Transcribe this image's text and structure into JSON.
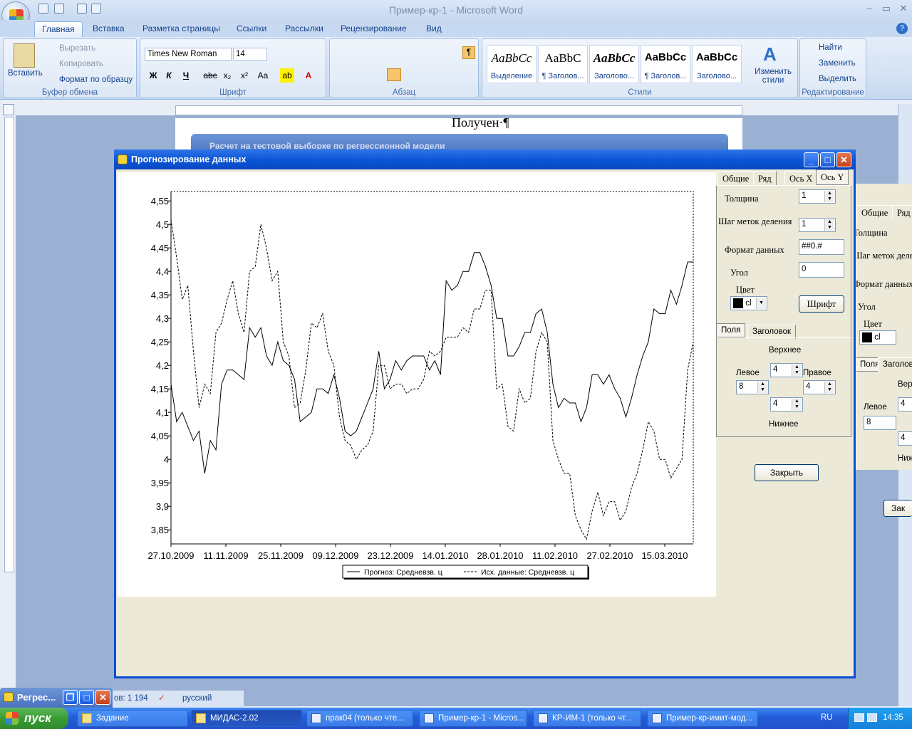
{
  "word": {
    "title": "Пример-кр-1 - Microsoft Word",
    "tabs": [
      "Главная",
      "Вставка",
      "Разметка страницы",
      "Ссылки",
      "Рассылки",
      "Рецензирование",
      "Вид"
    ],
    "clipboard": {
      "paste": "Вставить",
      "cut": "Вырезать",
      "copy": "Копировать",
      "format_painter": "Формат по образцу",
      "label": "Буфер обмена"
    },
    "font": {
      "name": "Times New Roman",
      "size": "14",
      "label": "Шрифт"
    },
    "paragraph_label": "Абзац",
    "styles": {
      "label": "Стили",
      "cards": [
        {
          "sample": "AaBbCc",
          "name": "Выделение"
        },
        {
          "sample": "AaBbC",
          "name": "¶ Заголов..."
        },
        {
          "sample": "AaBbCc",
          "name": "Заголово..."
        },
        {
          "sample": "AaBbCc",
          "name": "¶ Заголов..."
        },
        {
          "sample": "AaBbCc",
          "name": "Заголово..."
        }
      ],
      "change": "Изменить стили"
    },
    "editing": {
      "find": "Найти",
      "replace": "Заменить",
      "select": "Выделить",
      "label": "Редактирование"
    },
    "doc_heading": "Получен·¶"
  },
  "bg_dialog_title": "Расчет на тестовой выборке по регрессионной модели",
  "dialog": {
    "title": "Прогнозирование данных",
    "tabs": [
      "Общие",
      "Ряд",
      "Ось X",
      "Ось Y"
    ],
    "fields": {
      "thickness_label": "Толщина",
      "thickness": "1",
      "tick_step_label": "Шаг меток деления",
      "tick_step": "1",
      "format_label": "Формат данных",
      "format": "##0.#",
      "angle_label": "Угол",
      "angle": "0",
      "color_label": "Цвет",
      "color_value": "cl"
    },
    "font_button": "Шрифт",
    "subtabs": [
      "Поля",
      "Заголовок"
    ],
    "margins": {
      "top_label": "Верхнее",
      "top": "4",
      "left_label": "Левое",
      "left": "8",
      "right_label": "Правое",
      "right": "4",
      "bottom_label": "Нижнее",
      "bottom": "4"
    },
    "close_button": "Закрыть"
  },
  "dup_panel": {
    "tabs": [
      "Общие",
      "Ряд"
    ],
    "labels": [
      "Толщина",
      "Шаг меток делен",
      "Формат данных",
      "Угол",
      "Цвет"
    ],
    "color_value": "cl",
    "subtabs": [
      "Поля",
      "Заголовок"
    ],
    "margin_labels": [
      "Верх",
      "Левое",
      "Ниж"
    ],
    "values": [
      "4",
      "8",
      "4"
    ],
    "close_partial": "Зак"
  },
  "mini_window": {
    "title": "Регрес..."
  },
  "status": {
    "words": "ов: 1 194",
    "language": "русский"
  },
  "taskbar": {
    "start": "пуск",
    "items": [
      "Задание",
      "МИДАС-2.02",
      "прак04 (только чте...",
      "Пример-кр-1 - Micros...",
      "КР-ИМ-1 (только чт...",
      "Пример-кр-имит-мод..."
    ],
    "lang": "RU",
    "time": "14:35"
  },
  "chart_data": {
    "type": "line",
    "x_tick_labels": [
      "27.10.2009",
      "11.11.2009",
      "25.11.2009",
      "09.12.2009",
      "23.12.2009",
      "14.01.2010",
      "28.01.2010",
      "11.02.2010",
      "27.02.2010",
      "15.03.2010"
    ],
    "y_tick_labels": [
      "4,55",
      "4,5",
      "4,45",
      "4,4",
      "4,35",
      "4,3",
      "4,25",
      "4,2",
      "4,15",
      "4,1",
      "4,05",
      "4",
      "3,95",
      "3,9",
      "3,85"
    ],
    "ylim": [
      3.82,
      4.57
    ],
    "legend_placement": "bottom",
    "series": [
      {
        "name": "Прогноз: Средневзв. ц",
        "style": "solid",
        "values": [
          4.16,
          4.08,
          4.1,
          4.07,
          4.04,
          4.06,
          3.97,
          4.04,
          4.02,
          4.16,
          4.19,
          4.19,
          4.18,
          4.17,
          4.28,
          4.26,
          4.28,
          4.22,
          4.2,
          4.25,
          4.21,
          4.2,
          4.17,
          4.08,
          4.09,
          4.1,
          4.15,
          4.15,
          4.14,
          4.18,
          4.13,
          4.06,
          4.05,
          4.06,
          4.09,
          4.12,
          4.15,
          4.23,
          4.15,
          4.17,
          4.21,
          4.19,
          4.21,
          4.22,
          4.22,
          4.22,
          4.19,
          4.21,
          4.18,
          4.38,
          4.36,
          4.37,
          4.4,
          4.4,
          4.44,
          4.44,
          4.41,
          4.37,
          4.3,
          4.3,
          4.22,
          4.22,
          4.24,
          4.27,
          4.27,
          4.31,
          4.32,
          4.27,
          4.16,
          4.11,
          4.13,
          4.12,
          4.12,
          4.08,
          4.11,
          4.18,
          4.18,
          4.16,
          4.18,
          4.15,
          4.13,
          4.09,
          4.13,
          4.18,
          4.22,
          4.25,
          4.32,
          4.31,
          4.31,
          4.36,
          4.33,
          4.37,
          4.42,
          4.42
        ]
      },
      {
        "name": "Исх. данные: Средневзв. ц",
        "style": "dashed",
        "values": [
          4.51,
          4.43,
          4.34,
          4.37,
          4.23,
          4.11,
          4.16,
          4.14,
          4.27,
          4.29,
          4.34,
          4.38,
          4.31,
          4.27,
          4.4,
          4.41,
          4.5,
          4.45,
          4.38,
          4.4,
          4.25,
          4.22,
          4.11,
          4.12,
          4.19,
          4.29,
          4.28,
          4.31,
          4.23,
          4.2,
          4.09,
          4.04,
          4.03,
          4.0,
          4.02,
          4.03,
          4.06,
          4.2,
          4.2,
          4.15,
          4.16,
          4.16,
          4.14,
          4.15,
          4.15,
          4.17,
          4.23,
          4.22,
          4.23,
          4.26,
          4.26,
          4.26,
          4.28,
          4.27,
          4.32,
          4.32,
          4.36,
          4.36,
          4.15,
          4.16,
          4.07,
          4.06,
          4.15,
          4.12,
          4.13,
          4.23,
          4.27,
          4.25,
          4.04,
          4.0,
          3.97,
          3.97,
          3.88,
          3.85,
          3.83,
          3.89,
          3.93,
          3.88,
          3.91,
          3.91,
          3.87,
          3.89,
          3.94,
          3.97,
          4.02,
          4.08,
          4.06,
          4.0,
          4.0,
          3.96,
          3.98,
          4.0,
          4.19,
          4.25
        ]
      }
    ]
  }
}
